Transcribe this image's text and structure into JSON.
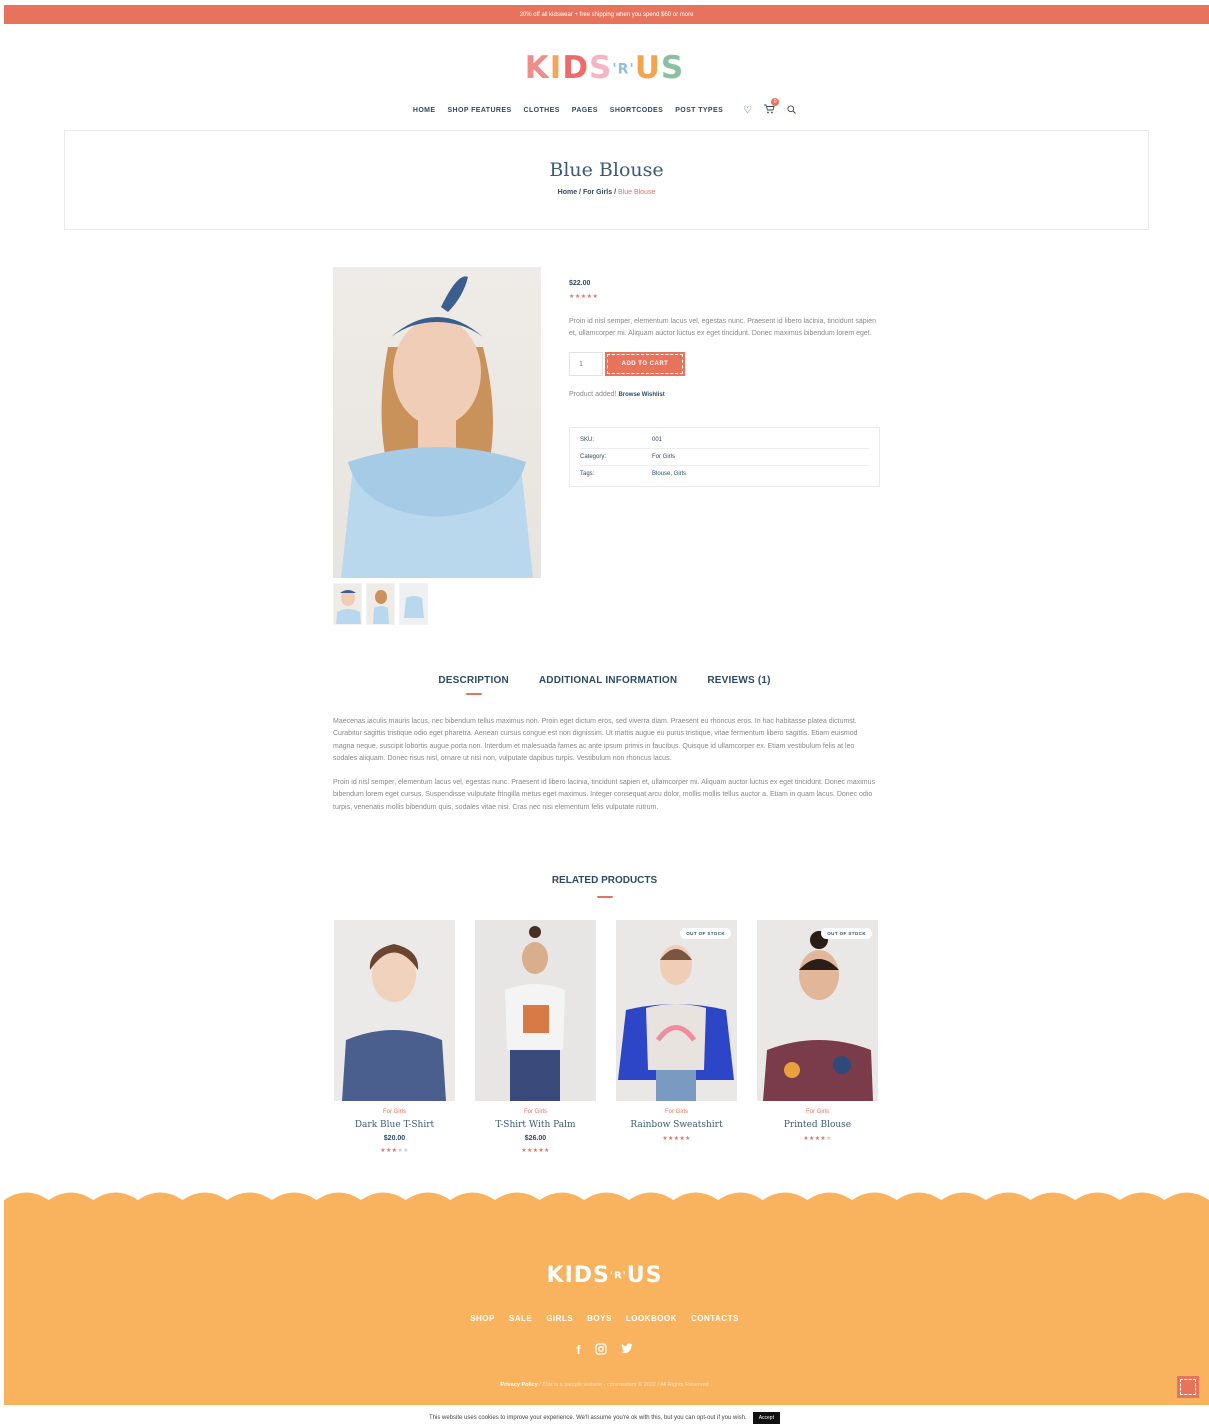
{
  "topbar": {
    "text": "20% off all kidswear + free shipping when you spend $60 or more"
  },
  "logo": {
    "text": "KIDS'R'US"
  },
  "nav": {
    "items": [
      "HOME",
      "SHOP FEATURES",
      "CLOTHES",
      "PAGES",
      "SHORTCODES",
      "POST TYPES"
    ],
    "cart_count": "0",
    "icons": [
      "heart-icon",
      "cart-icon",
      "search-icon"
    ]
  },
  "hero": {
    "title": "Blue Blouse",
    "crumb_home": "Home",
    "crumb_sep1": " / ",
    "crumb_cat": "For Girls",
    "crumb_sep2": " / ",
    "crumb_current": "Blue Blouse"
  },
  "product": {
    "price": "$22.00",
    "rating": 5,
    "description": "Proin id nisl semper, elementum lacus vel, egestas nunc. Praesent id libero lacinia, tincidunt sapien et, ullamcorper mi. Aliquam auctor luctus ex eget tincidunt. Donec maximus bibendum lorem eget.",
    "qty": "1",
    "add_to_cart": "ADD TO CART",
    "added_text": "Product added!",
    "browse_wishlist": "Browse Wishlist",
    "meta": {
      "sku_label": "SKU:",
      "sku": "001",
      "category_label": "Category:",
      "category": "For Girls",
      "tags_label": "Tags:",
      "tags": "Blouse, Girls"
    }
  },
  "tabs": {
    "description": "DESCRIPTION",
    "additional": "ADDITIONAL INFORMATION",
    "reviews": "REVIEWS (1)"
  },
  "long_description": {
    "p1": "Maecenas iaculis mauris lacus, nec bibendum tellus maximus non. Proin eget dictum eros, sed viverra diam. Praesent eu rhoncus eros. In hac habitasse platea dictumst. Curabitur sagittis tristique odio eget pharetra. Aenean cursus congue est non dignissim. Ut mattis augue eu purus tristique, vitae fermentum libero sagittis. Etiam euismod magna neque, suscipit lobortis augue porta non. Interdum et malesuada fames ac ante ipsum primis in faucibus. Quisque id ullamcorper ex. Etiam vestibulum felis at leo sodales aliquam. Donec risus nisl, ornare ut nisi non, vulputate dapibus turpis. Vestibulum non rhoncus lacus.",
    "p2": "Proin id nisl semper, elementum lacus vel, egestas nunc. Praesent id libero lacinia, tincidunt sapien et, ullamcorper mi. Aliquam auctor luctus ex eget tincidunt. Donec maximus bibendum lorem eget cursus. Suspendisse vulputate fringilla metus eget maximus. Integer consequat arcu dolor, mollis mollis tellus auctor a. Etiam in quam lacus. Donec odio turpis, venenatis mollis bibendum quis, sodales vitae nisi. Cras nec nisi elementum felis vulputate rutrum."
  },
  "related": {
    "title": "RELATED PRODUCTS",
    "items": [
      {
        "category": "For Girls",
        "name": "Dark Blue T-Shirt",
        "price": "$20.00",
        "rating": 3,
        "out_of_stock": "",
        "tint": "#4b5f8f"
      },
      {
        "category": "For Girls",
        "name": "T-Shirt With Palm",
        "price": "$26.00",
        "rating": 5,
        "out_of_stock": "",
        "tint": "#f2f2f2"
      },
      {
        "category": "For Girls",
        "name": "Rainbow Sweatshirt",
        "price": "",
        "rating": 5,
        "out_of_stock": "OUT OF STOCK",
        "tint": "#2d45c7"
      },
      {
        "category": "For Girls",
        "name": "Printed Blouse",
        "price": "",
        "rating": 4,
        "out_of_stock": "OUT OF STOCK",
        "tint": "#7a3b4a"
      }
    ]
  },
  "footer": {
    "logo": "KIDS'R'US",
    "nav": [
      "SHOP",
      "SALE",
      "GIRLS",
      "BOYS",
      "LOOKBOOK",
      "CONTACTS"
    ],
    "social": [
      "facebook-icon",
      "instagram-icon",
      "twitter-icon"
    ],
    "privacy": "Privacy Policy",
    "copyright": " / This is a sample website - cmsmasters © 2022 / All Rights Reserved"
  },
  "cookie": {
    "text": "This website uses cookies to improve your experience. We'll assume you're ok with this, but you can opt-out if you wish.",
    "accept": "Accept"
  },
  "colors": {
    "accent": "#e8735c",
    "navy": "#2f4a63",
    "footer": "#f9b35e"
  }
}
